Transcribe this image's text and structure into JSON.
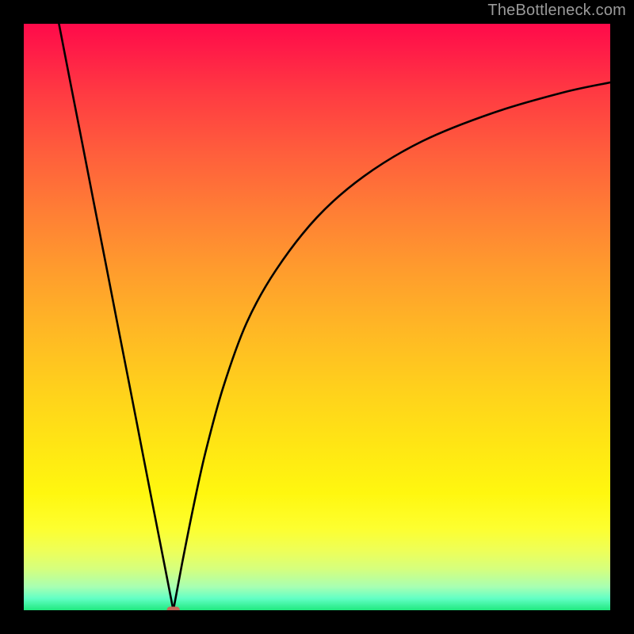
{
  "watermark": "TheBottleneck.com",
  "colors": {
    "background": "#000000",
    "curve_stroke": "#000000",
    "marker_fill": "#c76a5a",
    "marker_stroke": "#a2483b"
  },
  "chart_data": {
    "type": "line",
    "title": "",
    "xlabel": "",
    "ylabel": "",
    "x_range": [
      0,
      100
    ],
    "y_range": [
      0,
      100
    ],
    "axes_visible": false,
    "grid": false,
    "series": [
      {
        "name": "left-branch",
        "x": [
          6,
          8,
          10,
          12,
          14,
          16,
          18,
          20,
          22,
          24,
          25.5
        ],
        "y": [
          100,
          89.7,
          79.5,
          69.2,
          59.0,
          48.7,
          38.5,
          28.2,
          17.9,
          7.7,
          0
        ]
      },
      {
        "name": "right-branch",
        "x": [
          25.5,
          27,
          29,
          31,
          34,
          38,
          43,
          50,
          58,
          68,
          80,
          92,
          100
        ],
        "y": [
          0,
          8,
          18,
          27,
          38,
          49,
          58,
          67,
          74,
          80,
          84.8,
          88.3,
          90
        ]
      }
    ],
    "marker": {
      "name": "vertex-marker",
      "shape": "rounded-rect",
      "x": 25.5,
      "y": 0,
      "width": 2.2,
      "height": 1.2
    },
    "gradient_stops": [
      {
        "pos": 0.0,
        "color": "#ff0a4a"
      },
      {
        "pos": 0.22,
        "color": "#ff5e3c"
      },
      {
        "pos": 0.52,
        "color": "#ffb725"
      },
      {
        "pos": 0.8,
        "color": "#fff70f"
      },
      {
        "pos": 0.93,
        "color": "#d5ff7e"
      },
      {
        "pos": 1.0,
        "color": "#20e97f"
      }
    ]
  }
}
